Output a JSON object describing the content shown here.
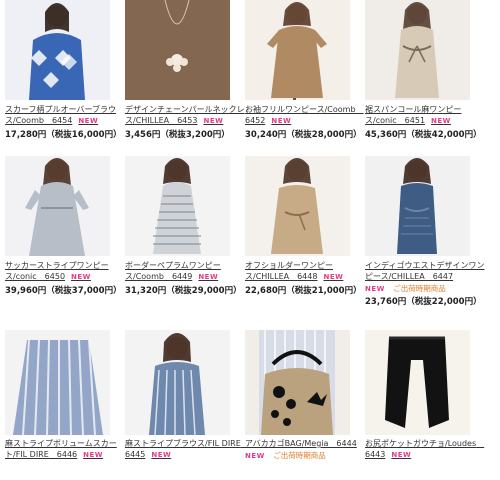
{
  "items": [
    {
      "name": "スカーフ柄プルオーバーブラウス/Coomb　6454",
      "price": "17,280円（税抜16,000円）",
      "new": "NEW",
      "colors": {
        "bg": "#eef0f5",
        "main": "#3a67b5",
        "accent": "#ffffff"
      }
    },
    {
      "name": "デザインチェーンパールネックレス/CHILLEA　6453",
      "price": "3,456円（税抜3,200円）",
      "new": "NEW",
      "colors": {
        "bg": "#8a6e56",
        "main": "#5b4534",
        "accent": "#d9c7a6"
      }
    },
    {
      "name": "お袖フリルワンピース/Coomb　6452",
      "price": "30,240円（税抜28,000円）",
      "new": "NEW",
      "colors": {
        "bg": "#f4efe9",
        "main": "#b08a63",
        "accent": "#6b4f39"
      }
    },
    {
      "name": "裾スパンコール麻ワンピース/conic　6451",
      "price": "45,360円（税抜42,000円）",
      "new": "NEW",
      "colors": {
        "bg": "#f0ede8",
        "main": "#d7cbb7",
        "accent": "#7b6a57"
      }
    },
    {
      "name": "サッカーストライプワンピース/conic　6450",
      "price": "39,960円（税抜37,000円）",
      "new": "NEW",
      "colors": {
        "bg": "#f2f2f4",
        "main": "#b8bec8",
        "accent": "#5f6773"
      }
    },
    {
      "name": "ボーダーペプラムワンピース/Coomb　6449",
      "price": "31,320円（税抜29,000円）",
      "new": "NEW",
      "colors": {
        "bg": "#f3f3f3",
        "main": "#cfd2d6",
        "accent": "#7d8794"
      }
    },
    {
      "name": "オフショルダーワンピース/CHILLEA　6448",
      "price": "22,680円（税抜21,000円）",
      "new": "NEW",
      "colors": {
        "bg": "#f4f1ed",
        "main": "#c7ab86",
        "accent": "#8b6d4a"
      }
    },
    {
      "name": "インディゴウエストデザインワンピース/CHILLEA　6447",
      "new": "NEW",
      "extra": "ご出荷時期商品",
      "price": "23,760円（税抜22,000円）",
      "colors": {
        "bg": "#f1f1f1",
        "main": "#3f5d84",
        "accent": "#6e84a7"
      }
    },
    {
      "name": "麻ストライプボリュームスカート/FIL DIRE　6446",
      "new": "NEW",
      "colors": {
        "bg": "#f3f3f3",
        "main": "#93a6c7",
        "accent": "#ffffff"
      }
    },
    {
      "name": "麻ストライプブラウス/FIL DIRE　6445",
      "new": "NEW",
      "colors": {
        "bg": "#f3f3f3",
        "main": "#6f88ad",
        "accent": "#ffffff"
      }
    },
    {
      "name": "アバカカゴBAG/Megia　6444",
      "new": "NEW",
      "extra": "ご出荷時期商品",
      "colors": {
        "bg": "#f1eee9",
        "main": "#b9a27d",
        "accent": "#111111"
      }
    },
    {
      "name": "お尻ポケットガウチョ/Loudes　6443",
      "new": "NEW",
      "colors": {
        "bg": "#f6f2ec",
        "main": "#121212",
        "accent": "#2b2b2b"
      }
    }
  ]
}
